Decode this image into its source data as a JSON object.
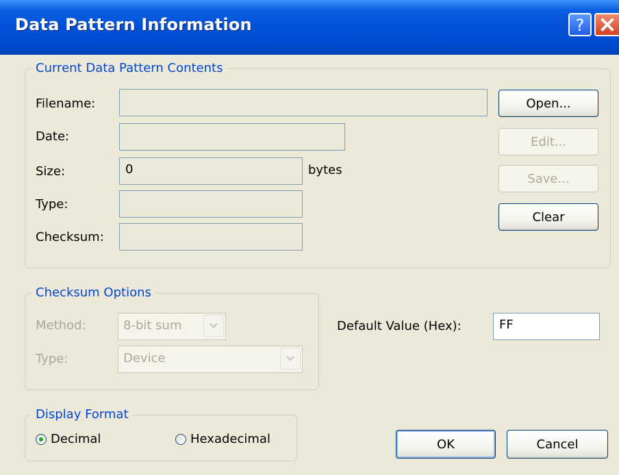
{
  "window": {
    "title": "Data Pattern Information",
    "help_icon": "help-icon",
    "close_icon": "close-icon"
  },
  "contents": {
    "legend": "Current Data Pattern Contents",
    "filename_label": "Filename:",
    "filename_value": "",
    "date_label": "Date:",
    "date_value": "",
    "size_label": "Size:",
    "size_value": "0",
    "size_unit": "bytes",
    "type_label": "Type:",
    "type_value": "",
    "checksum_label": "Checksum:",
    "checksum_value": ""
  },
  "actions": {
    "open": "Open...",
    "edit": "Edit...",
    "save": "Save...",
    "clear": "Clear"
  },
  "checksum_options": {
    "legend": "Checksum Options",
    "method_label": "Method:",
    "method_value": "8-bit sum",
    "type_label": "Type:",
    "type_value": "Device"
  },
  "default_value": {
    "label": "Default Value (Hex):",
    "value": "FF"
  },
  "display_format": {
    "legend": "Display Format",
    "decimal": "Decimal",
    "hexadecimal": "Hexadecimal",
    "selected": "Decimal"
  },
  "footer": {
    "ok": "OK",
    "cancel": "Cancel"
  },
  "colors": {
    "title_bar": "#0251d8",
    "dialog_bg": "#ece9d8",
    "legend_text": "#0046d5",
    "disabled_text": "#aca899",
    "close_button": "#d2411e"
  }
}
